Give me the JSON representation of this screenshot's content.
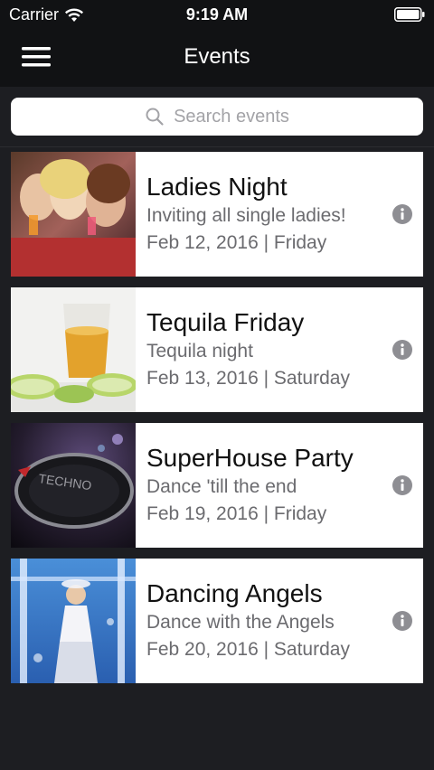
{
  "status_bar": {
    "carrier": "Carrier",
    "time": "9:19 AM",
    "wifi_icon": "wifi-icon",
    "battery_icon": "battery-icon"
  },
  "nav": {
    "title": "Events",
    "menu_icon": "hamburger-menu-icon"
  },
  "search": {
    "placeholder": "Search events",
    "icon": "search-icon"
  },
  "events": [
    {
      "title": "Ladies Night",
      "subtitle": "Inviting all single ladies!",
      "date": "Feb 12, 2016 | Friday",
      "image": "party-women-photo",
      "info_icon": "info-icon"
    },
    {
      "title": "Tequila Friday",
      "subtitle": "Tequila night",
      "date": "Feb 13, 2016 | Saturday",
      "image": "tequila-shot-photo",
      "info_icon": "info-icon"
    },
    {
      "title": "SuperHouse Party",
      "subtitle": "Dance 'till the end",
      "date": "Feb 19, 2016 | Friday",
      "image": "dj-turntable-photo",
      "info_icon": "info-icon"
    },
    {
      "title": "Dancing Angels",
      "subtitle": "Dance with the Angels",
      "date": "Feb 20, 2016 | Saturday",
      "image": "dancer-stage-photo",
      "info_icon": "info-icon"
    }
  ],
  "colors": {
    "background": "#1d1e22",
    "bar": "#111214",
    "card": "#ffffff",
    "title_text": "#111111",
    "secondary_text": "#6b6b6f",
    "info_icon": "#8e8e93"
  }
}
